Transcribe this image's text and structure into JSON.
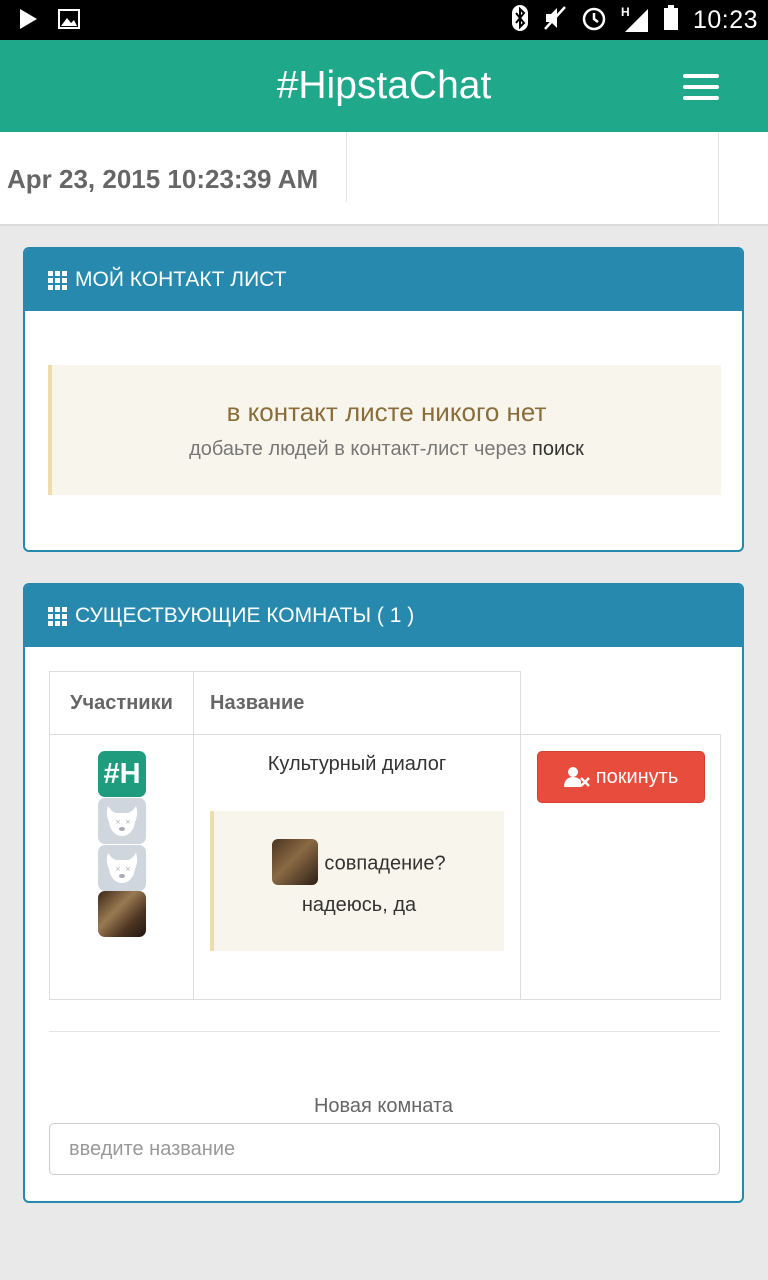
{
  "status_bar": {
    "time": "10:23",
    "icons": [
      "play-icon",
      "image-icon",
      "bluetooth-icon",
      "mute-icon",
      "alarm-icon",
      "signal-icon",
      "battery-icon"
    ],
    "network_label": "H"
  },
  "app": {
    "title": "#HipstaChat",
    "menu_icon": "hamburger-icon",
    "accent_color": "#1fa88a",
    "panel_color": "#2689ad"
  },
  "date": "Apr 23, 2015 10:23:39 AM",
  "contacts_panel": {
    "title": "МОЙ КОНТАКТ ЛИСТ",
    "empty_title": "в контакт листе никого нет",
    "empty_text": "добаьте людей в контакт-лист через",
    "search_link": "поиск"
  },
  "rooms_panel": {
    "title": "СУЩЕСТВУЮЩИЕ КОМНАТЫ ( 1 )",
    "columns": [
      "Участники",
      "Название"
    ],
    "rooms": [
      {
        "name": "Культурный диалог",
        "participants": [
          "#H",
          "dog-avatar",
          "dog-avatar",
          "photo-avatar"
        ],
        "last_message_line1": "совпадение?",
        "last_message_line2": "надеюсь, да",
        "leave_label": "покинуть",
        "leave_color": "#e74c3c"
      }
    ],
    "new_room_label": "Новая комната",
    "new_room_placeholder": "введите название"
  }
}
